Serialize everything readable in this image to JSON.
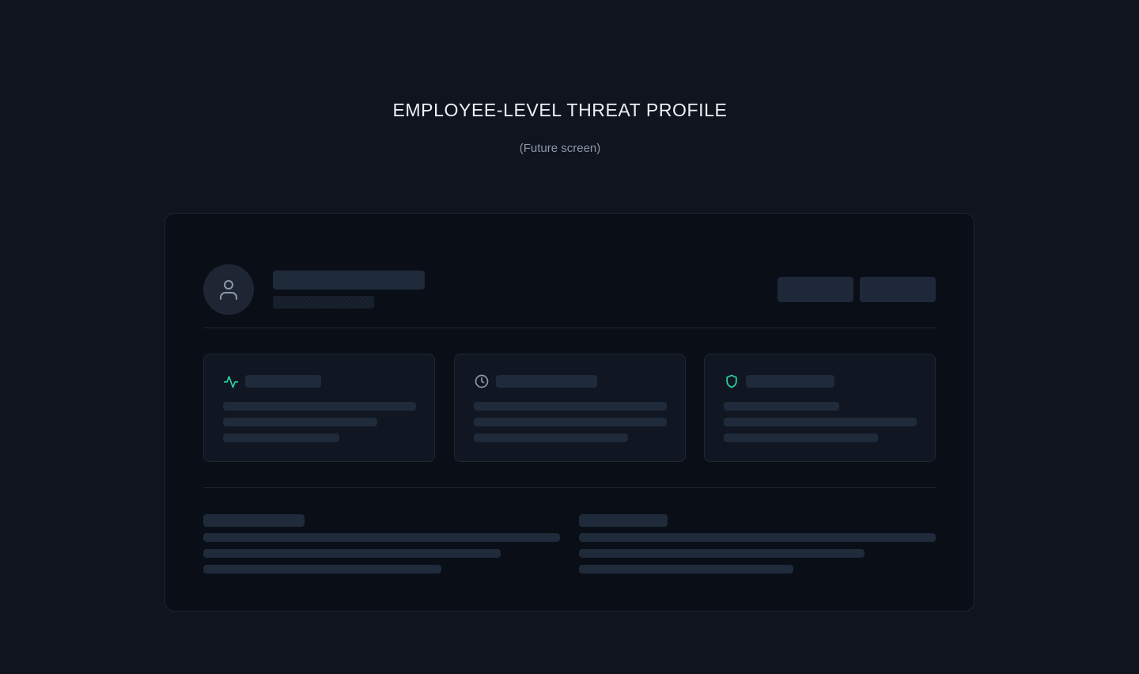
{
  "heading": {
    "title": "EMPLOYEE-LEVEL THREAT PROFILE",
    "subtitle": "(Future screen)"
  },
  "colors": {
    "accent": "#2bd4a4",
    "background": "#0f141e",
    "frame": "#0a0e16",
    "skeleton": "#1f2a3a"
  },
  "cards": [
    {
      "icon": "activity-icon"
    },
    {
      "icon": "clock-icon"
    },
    {
      "icon": "shield-icon"
    }
  ],
  "avatar": {
    "icon": "user-icon"
  }
}
